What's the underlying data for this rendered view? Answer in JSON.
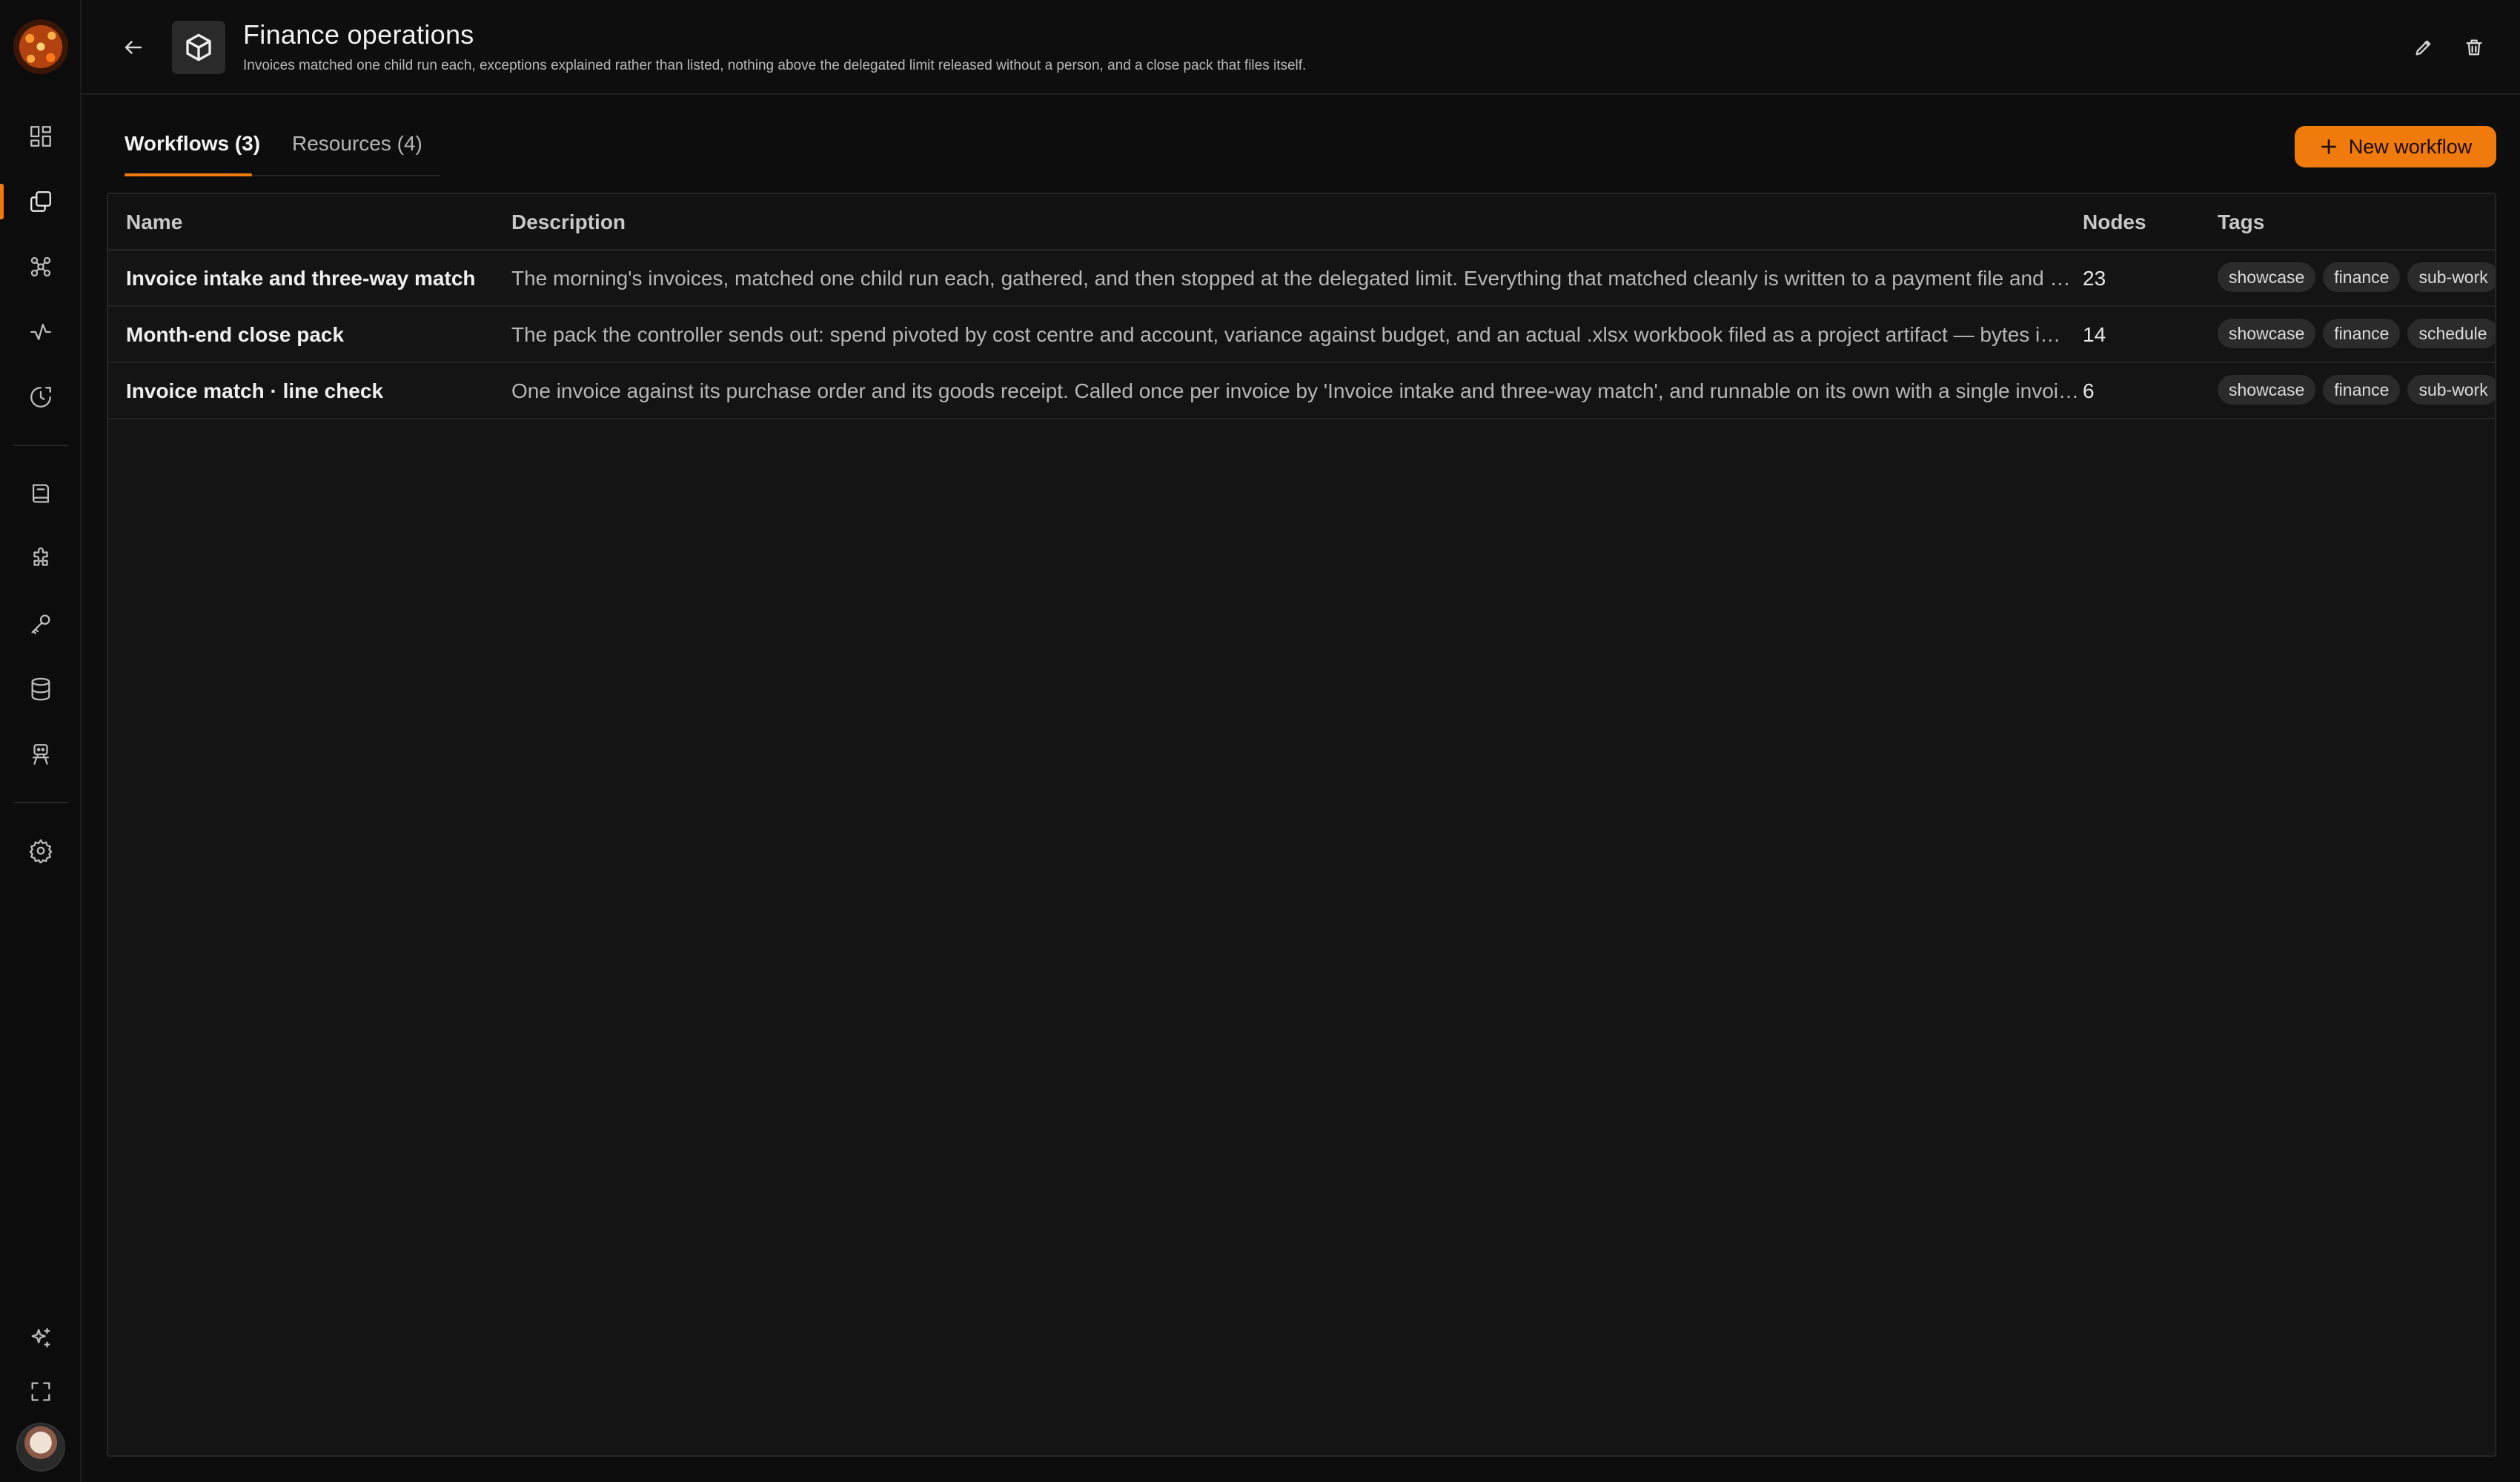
{
  "header": {
    "title": "Finance operations",
    "subtitle": "Invoices matched one child run each, exceptions explained rather than listed, nothing above the delegated limit released without a person, and a close pack that files itself."
  },
  "tabs": [
    {
      "label": "Workflows (3)",
      "active": true
    },
    {
      "label": "Resources (4)",
      "active": false
    }
  ],
  "new_workflow_label": "New workflow",
  "table": {
    "columns": [
      "Name",
      "Description",
      "Nodes",
      "Tags"
    ],
    "rows": [
      {
        "name": "Invoice intake and three-way match",
        "description": "The morning's invoices, matched one child run each, gathered, and then stopped at the delegated limit. Everything that matched cleanly is written to a payment file and …",
        "nodes": "23",
        "tags": [
          "showcase",
          "finance",
          "sub-work"
        ]
      },
      {
        "name": "Month-end close pack",
        "description": "The pack the controller sends out: spend pivoted by cost centre and account, variance against budget, and an actual .xlsx workbook filed as a project artifact — bytes i…",
        "nodes": "14",
        "tags": [
          "showcase",
          "finance",
          "schedule"
        ]
      },
      {
        "name": "Invoice match · line check",
        "description": "One invoice against its purchase order and its goods receipt. Called once per invoice by 'Invoice intake and three-way match', and runnable on its own with a single invoi…",
        "nodes": "6",
        "tags": [
          "showcase",
          "finance",
          "sub-work"
        ]
      }
    ]
  },
  "colors": {
    "accent": "#f07a0c",
    "background": "#0d0d0d",
    "panel": "#141414"
  },
  "icons": {
    "sidebar": [
      "dashboard-icon",
      "projects-icon",
      "integrations-icon",
      "activity-icon",
      "history-icon",
      "docs-icon",
      "plugins-icon",
      "keys-icon",
      "database-icon",
      "agents-icon",
      "settings-icon",
      "sparkle-icon",
      "fullscreen-icon"
    ],
    "header": [
      "back-arrow-icon",
      "cube-icon",
      "pencil-icon",
      "trash-icon"
    ]
  }
}
